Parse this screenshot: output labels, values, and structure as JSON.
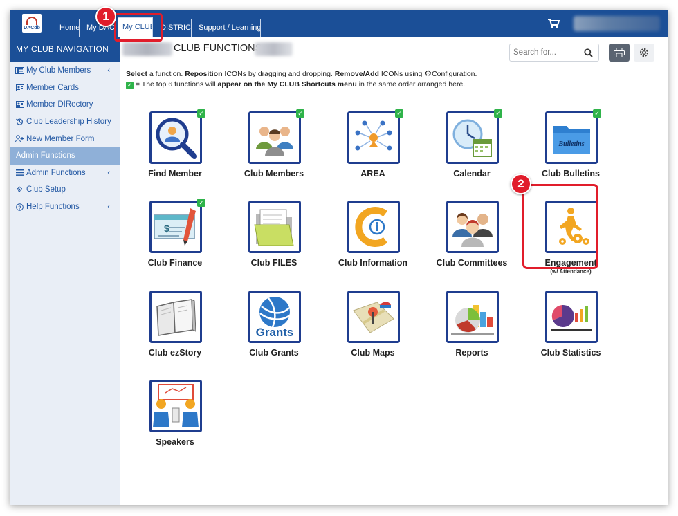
{
  "app": {
    "logo_text": "DACdb"
  },
  "tabs": [
    {
      "label": "Home"
    },
    {
      "label": "My DACdb"
    },
    {
      "label": "My CLUB"
    },
    {
      "label": "DISTRICT"
    },
    {
      "label": "Support / Learning"
    }
  ],
  "sidebar": {
    "title": "MY CLUB NAVIGATION",
    "items": [
      {
        "label": "My Club Members",
        "icon": "address-book-icon"
      },
      {
        "label": "Member Cards",
        "icon": "id-card-icon"
      },
      {
        "label": "Member DIRectory",
        "icon": "id-card-icon"
      },
      {
        "label": "Club Leadership History",
        "icon": "history-icon"
      },
      {
        "label": "New Member Form",
        "icon": "user-plus-icon"
      },
      {
        "label": "Admin Functions",
        "icon": ""
      },
      {
        "label": "Admin Functions",
        "icon": "list-icon"
      },
      {
        "label": "Club Setup",
        "icon": "cogs-icon"
      },
      {
        "label": "Help Functions",
        "icon": "question-icon"
      }
    ]
  },
  "main": {
    "title": "CLUB FUNCTIONS",
    "search_placeholder": "Search for...",
    "instructions": {
      "select": "Select",
      "a_function": " a function. ",
      "reposition": "Reposition",
      "reposition_rest": " ICONs by dragging and dropping. ",
      "remove_add": "Remove/Add",
      "remove_add_rest": " ICONs using ",
      "configuration": "Configuration.",
      "line2_a": " = The top 6 functions will ",
      "line2_b": "appear on the My CLUB Shortcuts menu",
      "line2_c": " in the same order arranged here."
    }
  },
  "functions": [
    {
      "label": "Find Member",
      "shortcut": true
    },
    {
      "label": "Club Members",
      "shortcut": true
    },
    {
      "label": "AREA",
      "shortcut": true
    },
    {
      "label": "Calendar",
      "shortcut": true
    },
    {
      "label": "Club Bulletins",
      "shortcut": true,
      "icon_text": "Bulletins"
    },
    {
      "label": "Club Finance",
      "shortcut": true
    },
    {
      "label": "Club FILES",
      "shortcut": false
    },
    {
      "label": "Club Information",
      "shortcut": false
    },
    {
      "label": "Club Committees",
      "shortcut": false
    },
    {
      "label": "Engagement",
      "sublabel": "(w/ Attendance)",
      "shortcut": false
    },
    {
      "label": "Club ezStory",
      "shortcut": false
    },
    {
      "label": "Club Grants",
      "shortcut": false,
      "icon_text": "Grants"
    },
    {
      "label": "Club Maps",
      "shortcut": false
    },
    {
      "label": "Reports",
      "shortcut": false
    },
    {
      "label": "Club Statistics",
      "shortcut": false
    },
    {
      "label": "Speakers",
      "shortcut": false
    }
  ],
  "callouts": [
    "1",
    "2"
  ],
  "colors": {
    "brand": "#1b4f97",
    "callout": "#e11d2b",
    "shortcut_check": "#2fb34a"
  }
}
